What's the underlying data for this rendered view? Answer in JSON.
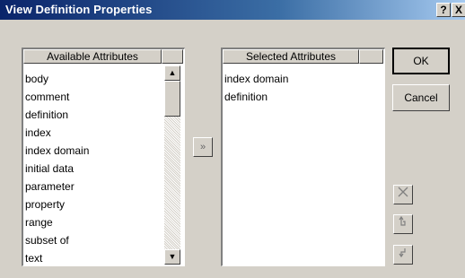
{
  "window": {
    "title": "View Definition Properties",
    "help_label": "?",
    "close_label": "X"
  },
  "available": {
    "header": "Available Attributes",
    "items": [
      "body",
      "comment",
      "definition",
      "index",
      "index domain",
      "initial data",
      "parameter",
      "property",
      "range",
      "subset of",
      "text"
    ]
  },
  "selected": {
    "header": "Selected Attributes",
    "items": [
      "index domain",
      "definition"
    ]
  },
  "buttons": {
    "move_right": "»",
    "ok": "OK",
    "cancel": "Cancel"
  },
  "icons": {
    "delete": "delete-x-icon",
    "move_up": "move-up-arrow-icon",
    "move_down": "move-down-arrow-icon",
    "scroll_up": "scroll-up-arrow-icon",
    "scroll_down": "scroll-down-arrow-icon"
  }
}
